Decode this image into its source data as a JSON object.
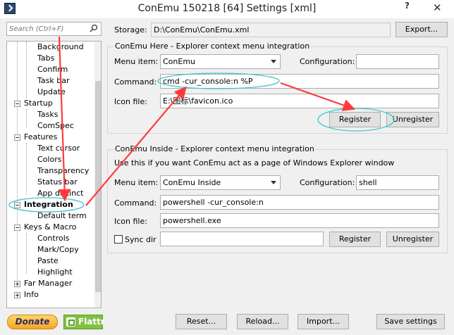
{
  "window": {
    "title": "ConEmu 150218 [64] Settings [xml]",
    "help": "?",
    "close": "✕"
  },
  "search": {
    "placeholder": "Search (Ctrl+F)"
  },
  "tree": {
    "items": [
      {
        "label": "Background"
      },
      {
        "label": "Tabs"
      },
      {
        "label": "Confirm"
      },
      {
        "label": "Task bar"
      },
      {
        "label": "Update"
      },
      {
        "label": "Startup"
      },
      {
        "label": "Tasks"
      },
      {
        "label": "ComSpec"
      },
      {
        "label": "Features"
      },
      {
        "label": "Text cursor"
      },
      {
        "label": "Colors"
      },
      {
        "label": "Transparency"
      },
      {
        "label": "Status bar"
      },
      {
        "label": "App distinct"
      },
      {
        "label": "Integration"
      },
      {
        "label": "Default term"
      },
      {
        "label": "Keys & Macro"
      },
      {
        "label": "Controls"
      },
      {
        "label": "Mark/Copy"
      },
      {
        "label": "Paste"
      },
      {
        "label": "Highlight"
      },
      {
        "label": "Far Manager"
      },
      {
        "label": "Info"
      }
    ]
  },
  "storage": {
    "label": "Storage:",
    "value": "D:\\ConEmu\\ConEmu.xml",
    "export_button": "Export..."
  },
  "here": {
    "legend": "ConEmu Here - Explorer context menu integration",
    "menu_item_label": "Menu item:",
    "menu_item_value": "ConEmu",
    "configuration_label": "Configuration:",
    "configuration_value": "",
    "command_label": "Command:",
    "command_value": "cmd -cur_console:n %P",
    "icon_label": "Icon file:",
    "icon_value": "E:\\图标\\favicon.ico",
    "register_button": "Register",
    "unregister_button": "Unregister"
  },
  "inside": {
    "legend": "ConEmu Inside - Explorer context menu integration",
    "description": "Use this if you want ConEmu act as a page of Windows Explorer window",
    "menu_item_label": "Menu item:",
    "menu_item_value": "ConEmu Inside",
    "configuration_label": "Configuration:",
    "configuration_value": "shell",
    "command_label": "Command:",
    "command_value": "powershell -cur_console:n",
    "icon_label": "Icon file:",
    "icon_value": "powershell.exe",
    "sync_dir_label": "Sync dir",
    "sync_dir_checked": false,
    "sync_dir_value": "",
    "register_button": "Register",
    "unregister_button": "Unregister"
  },
  "footer": {
    "donate": "Donate",
    "flattr": "Flattr",
    "reset": "Reset...",
    "reload": "Reload...",
    "import": "Import...",
    "save": "Save settings"
  },
  "colors": {
    "annotation": "#ff3b3b",
    "highlight_ellipse": "#3cc6c9"
  }
}
